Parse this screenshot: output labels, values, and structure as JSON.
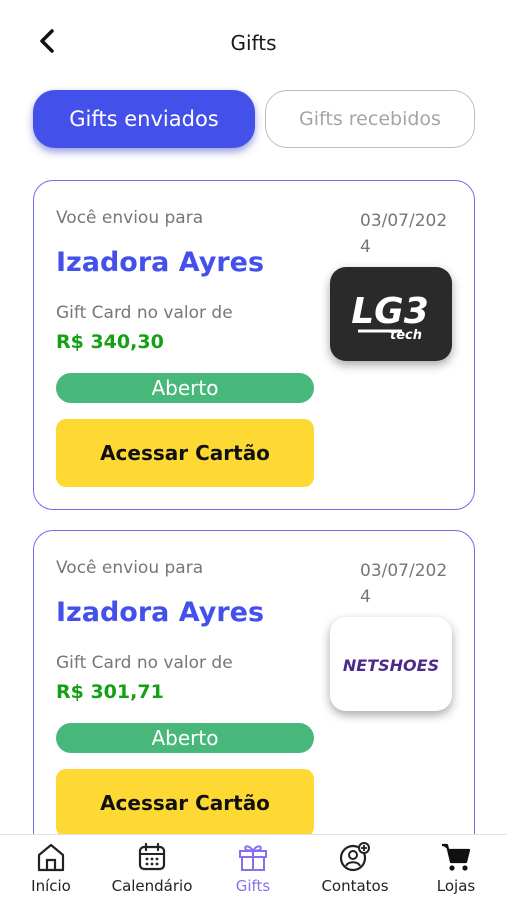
{
  "header": {
    "title": "Gifts",
    "back_icon": "chevron-left-icon"
  },
  "tabs": [
    {
      "label": "Gifts enviados",
      "active": true
    },
    {
      "label": "Gifts recebidos",
      "active": false
    }
  ],
  "gifts": [
    {
      "sent_to_label": "Você enviou para",
      "date": "03/07/2024",
      "recipient": "Izadora Ayres",
      "value_label": "Gift Card no valor de",
      "amount": "R$ 340,30",
      "status": "Aberto",
      "button_label": "Acessar Cartão",
      "store_logo": {
        "line1": "LG3",
        "line2": "tech"
      }
    },
    {
      "sent_to_label": "Você enviou para",
      "date": "03/07/2024",
      "recipient": "Izadora Ayres",
      "value_label": "Gift Card no valor de",
      "amount": "R$ 301,71",
      "status": "Aberto",
      "button_label": "Acessar Cartão",
      "store_logo": {
        "line1": "NETSHOES"
      }
    }
  ],
  "bottom_nav": [
    {
      "label": "Início",
      "icon": "home-icon",
      "active": false
    },
    {
      "label": "Calendário",
      "icon": "calendar-icon",
      "active": false
    },
    {
      "label": "Gifts",
      "icon": "gift-icon",
      "active": true
    },
    {
      "label": "Contatos",
      "icon": "contacts-icon",
      "active": false
    },
    {
      "label": "Lojas",
      "icon": "cart-icon",
      "active": false
    }
  ],
  "colors": {
    "primary": "#4450ea",
    "status_green": "#48b87a",
    "amount_green": "#14a014",
    "button_yellow": "#fed833",
    "nav_active": "#8a6ef0"
  }
}
